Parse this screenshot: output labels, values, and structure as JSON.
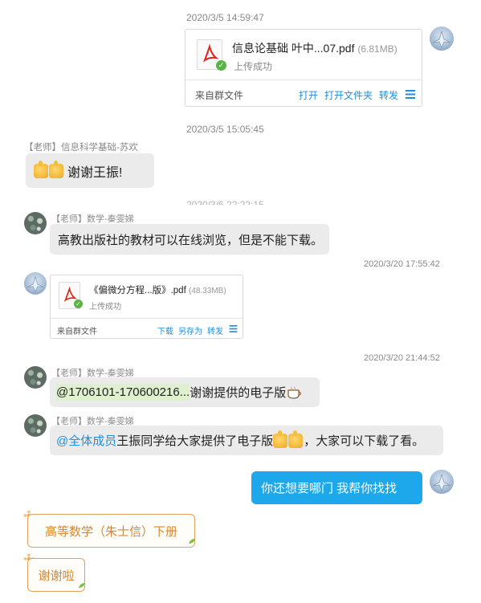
{
  "colors": {
    "accent_blue": "#1ca8ea",
    "link_blue": "#1f8ede",
    "bubble_gray": "#ebebeb",
    "orange": "#d9862e",
    "success_green": "#5ab345",
    "pdf_red": "#e2231a"
  },
  "messages": {
    "t1": "2020/3/5 14:59:47",
    "file1": {
      "name": "信息论基础 叶中...07.pdf",
      "size": "(6.81MB)",
      "status": "上传成功",
      "source": "来自群文件",
      "actions": [
        "打开",
        "打开文件夹",
        "转发"
      ],
      "icon": "menu-icon"
    },
    "t2": "2020/3/5 15:05:45",
    "sender_su": "【老师】信息科学基础-苏欢",
    "msg_su": "谢谢王振!",
    "t3_cut": "2020/3/6 22:22:15",
    "sender_qin": "【老师】数学-秦雯娣",
    "msg_qin1": "高教出版社的教材可以在线浏览，但是不能下载。",
    "t4": "2020/3/20 17:55:42",
    "file2": {
      "name": "《偏微分方程...版》.pdf",
      "size": "(48.33MB)",
      "status": "上传成功",
      "source": "来自群文件",
      "actions": [
        "下载",
        "另存为",
        "转发"
      ]
    },
    "t5": "2020/3/20 21:44:52",
    "msg_qin2_code": "@1706101-170600216...",
    "msg_qin2_text": " 谢谢提供的电子版",
    "msg_qin3_mention": "@全体成员",
    "msg_qin3_a": " 王振同学给大家提供了电子版",
    "msg_qin3_b": "，大家可以下载了看。",
    "msg_me": "你还想要哪门 我帮你找找",
    "msg_o1": "高等数学（朱士信）下册",
    "msg_o2": "谢谢啦"
  }
}
